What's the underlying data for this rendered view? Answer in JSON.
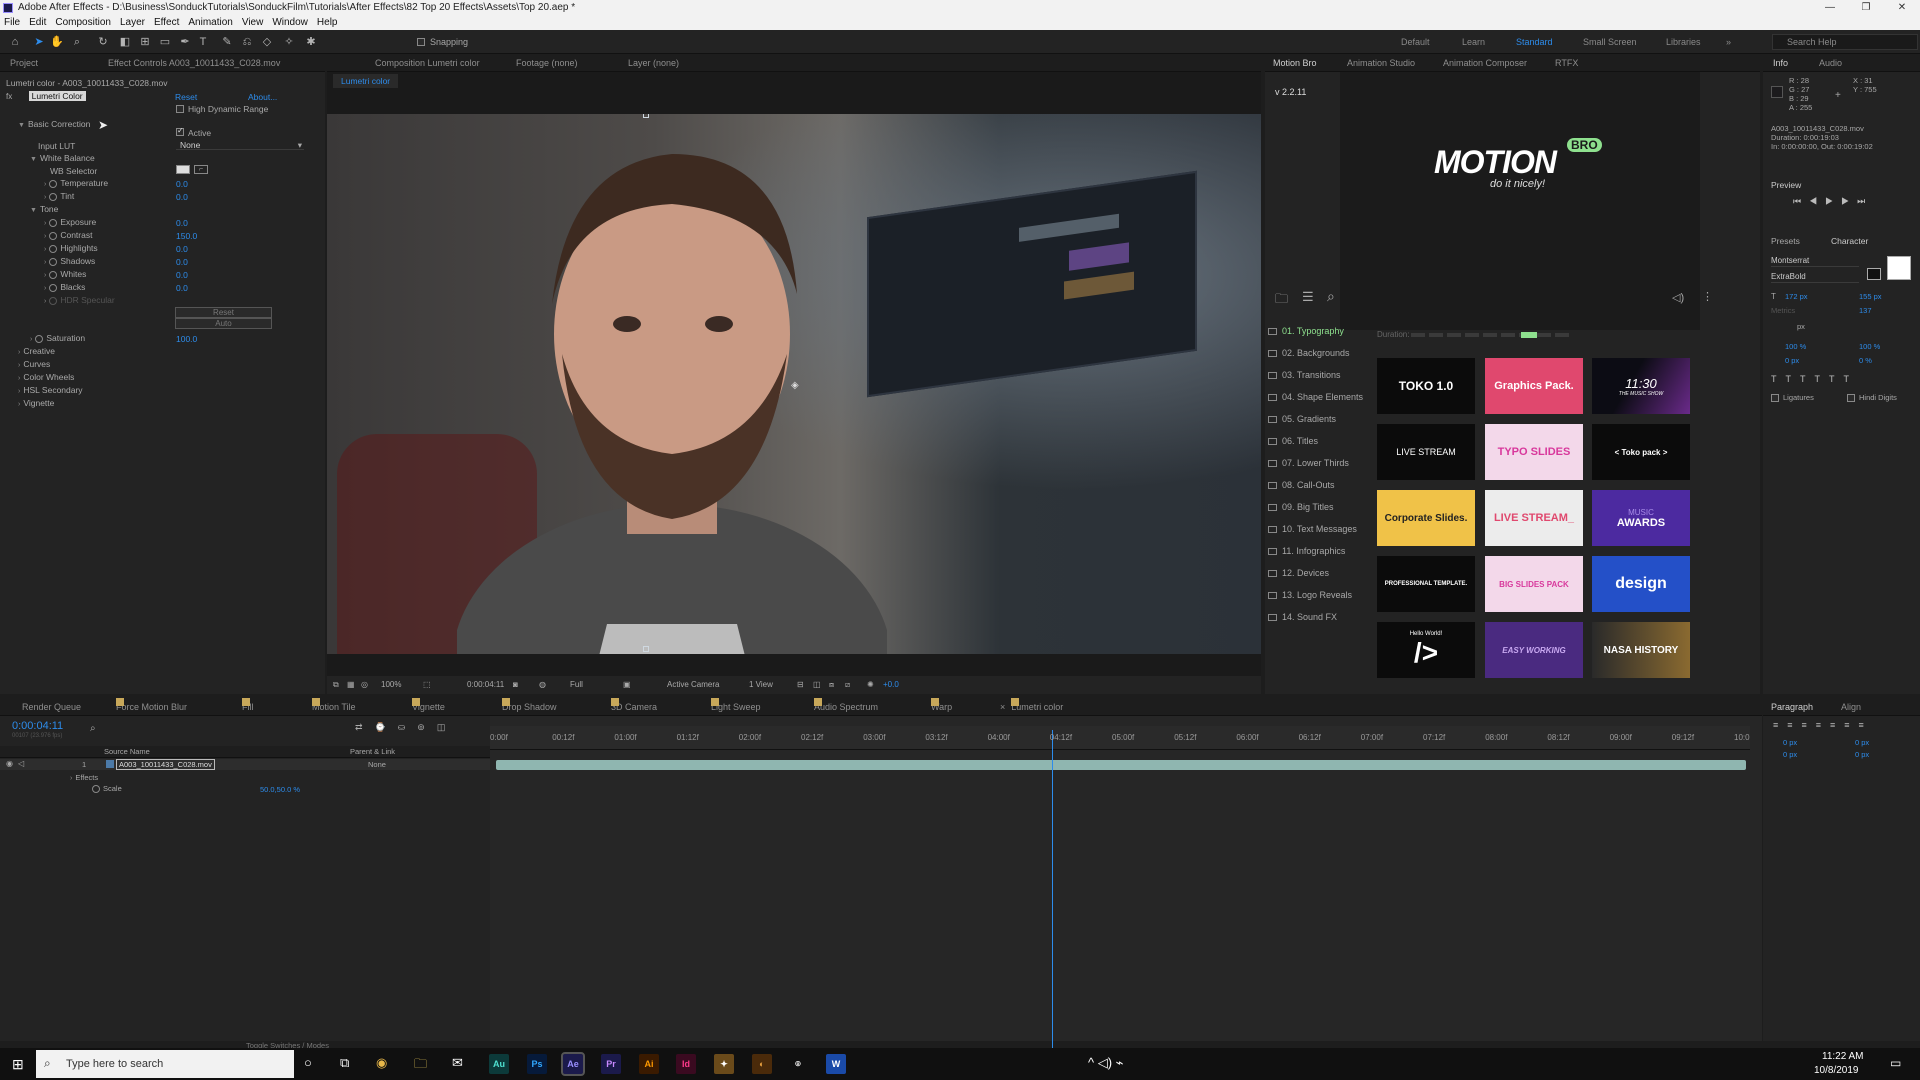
{
  "window": {
    "title": "Adobe After Effects - D:\\Business\\SonduckTutorials\\SonduckFilm\\Tutorials\\After Effects\\82 Top 20 Effects\\Assets\\Top 20.aep *",
    "minimize": "—",
    "maximize": "❐",
    "close": "✕"
  },
  "menu": [
    "File",
    "Edit",
    "Composition",
    "Layer",
    "Effect",
    "Animation",
    "View",
    "Window",
    "Help"
  ],
  "toolbar": {
    "snapping": "Snapping"
  },
  "workspaces": [
    "Default",
    "Learn",
    "Standard",
    "Small Screen",
    "Libraries"
  ],
  "search_help": "Search Help",
  "left_panel": {
    "tab_project": "Project",
    "tab_effect_controls": "Effect Controls",
    "tab_effect_controls_file": "A003_10011433_C028.mov",
    "layer_path": "Lumetri color - A003_10011433_C028.mov",
    "effect_name": "Lumetri Color",
    "reset": "Reset",
    "about": "About...",
    "hdr": "High Dynamic Range",
    "basic_correction": "Basic Correction",
    "active": "Active",
    "input_lut": "Input LUT",
    "input_lut_value": "None",
    "white_balance": "White Balance",
    "wb_selector": "WB Selector",
    "temperature": "Temperature",
    "temperature_val": "0.0",
    "tint": "Tint",
    "tint_val": "0.0",
    "tone": "Tone",
    "exposure": "Exposure",
    "exposure_val": "0.0",
    "contrast": "Contrast",
    "contrast_val": "150.0",
    "highlights": "Highlights",
    "highlights_val": "0.0",
    "shadows": "Shadows",
    "shadows_val": "0.0",
    "whites": "Whites",
    "whites_val": "0.0",
    "blacks": "Blacks",
    "blacks_val": "0.0",
    "hdr_specular": "HDR Specular",
    "btn_reset": "Reset",
    "btn_auto": "Auto",
    "saturation": "Saturation",
    "saturation_val": "100.0",
    "creative": "Creative",
    "curves": "Curves",
    "color_wheels": "Color Wheels",
    "hsl_secondary": "HSL Secondary",
    "vignette": "Vignette"
  },
  "comp_panel": {
    "tab_comp_prefix": "Composition",
    "tab_comp_name": "Lumetri color",
    "tab_footage": "Footage (none)",
    "tab_layer": "Layer (none)",
    "subtab": "Lumetri color",
    "zoom": "100%",
    "timecode": "0:00:04:11",
    "resolution": "Full",
    "camera": "Active Camera",
    "view": "1 View",
    "exposure": "+0.0"
  },
  "motion_bro": {
    "tabs": [
      "Motion Bro",
      "Animation Studio",
      "Animation Composer",
      "RTFX"
    ],
    "version": "v 2.2.11",
    "logo_main": "MOTION",
    "logo_badge": "BRO",
    "logo_tagline": "do it nicely!",
    "duration_label": "Duration:",
    "categories": [
      "01. Typography",
      "02. Backgrounds",
      "03. Transitions",
      "04. Shape Elements",
      "05. Gradients",
      "06. Titles",
      "07. Lower Thirds",
      "08. Call-Outs",
      "09. Big Titles",
      "10. Text Messages",
      "11. Infographics",
      "12. Devices",
      "13. Logo Reveals",
      "14. Sound FX"
    ],
    "thumbs": [
      "TOKO 1.0",
      "Graphics Pack.",
      "11:30",
      "LIVE STREAM",
      "TYPO SLIDES",
      "< Toko pack >",
      "Corporate Slides.",
      "LIVE STREAM_",
      "AWARDS",
      "PROFESSIONAL TEMPLATE.",
      "BIG SLIDES PACK",
      "design",
      "/>",
      "EASY WORKING",
      "NASA HISTORY"
    ],
    "thumb_sub_1130": "THE MUSIC SHOW",
    "thumb_sub_music": "MUSIC",
    "thumb_sub_hello": "Hello World!"
  },
  "info_panel": {
    "tab_info": "Info",
    "tab_audio": "Audio",
    "r": "R : 28",
    "g": "G : 27",
    "b": "B : 29",
    "a": "A : 255",
    "x": "X : 31",
    "y": "Y : 755",
    "file": "A003_10011433_C028.mov",
    "duration": "Duration: 0:00:19:03",
    "in_out": "In: 0:00:00:00, Out: 0:00:19:02",
    "preview": "Preview",
    "presets": "Presets",
    "character": "Character",
    "font": "Montserrat",
    "weight": "ExtraBold",
    "size": "172 px",
    "leading": "155 px",
    "tracking": "137",
    "metrics": "Metrics",
    "unit_px": "px",
    "scale_v": "100 %",
    "scale_h": "100 %",
    "baseline": "0 px",
    "tsume": "0 %",
    "ligatures": "Ligatures",
    "hindi": "Hindi Digits",
    "paragraph": "Paragraph",
    "align": "Align",
    "indent_left": "0 px",
    "indent_right": "0 px",
    "indent_first": "0 px",
    "space_before": "0 px",
    "space_after": "0 px"
  },
  "timeline": {
    "tabs": [
      "Render Queue",
      "Force Motion Blur",
      "Fill",
      "Motion Tile",
      "Vignette",
      "Drop Shadow",
      "3D Camera",
      "Light Sweep",
      "Audio Spectrum",
      "Warp",
      "Lumetri color"
    ],
    "timecode": "0:00:04:11",
    "timecode_sub": "00107 (23.976 fps)",
    "col_source_name": "Source Name",
    "col_parent": "Parent & Link",
    "layer_num": "1",
    "layer_name": "A003_10011433_C028.mov",
    "parent_value": "None",
    "effects": "Effects",
    "scale": "Scale",
    "scale_val": "50.0,50.0 %",
    "toggle": "Toggle Switches / Modes",
    "ruler": [
      "0:00f",
      "00:12f",
      "01:00f",
      "01:12f",
      "02:00f",
      "02:12f",
      "03:00f",
      "03:12f",
      "04:00f",
      "04:12f",
      "05:00f",
      "05:12f",
      "06:00f",
      "06:12f",
      "07:00f",
      "07:12f",
      "08:00f",
      "08:12f",
      "09:00f",
      "09:12f",
      "10:0"
    ],
    "playhead_fraction": 0.445
  },
  "taskbar": {
    "search": "Type here to search",
    "time": "11:22 AM",
    "date": "10/8/2019",
    "apps": [
      "Au",
      "Ps",
      "Ae",
      "Pr",
      "Ai",
      "Id"
    ]
  }
}
